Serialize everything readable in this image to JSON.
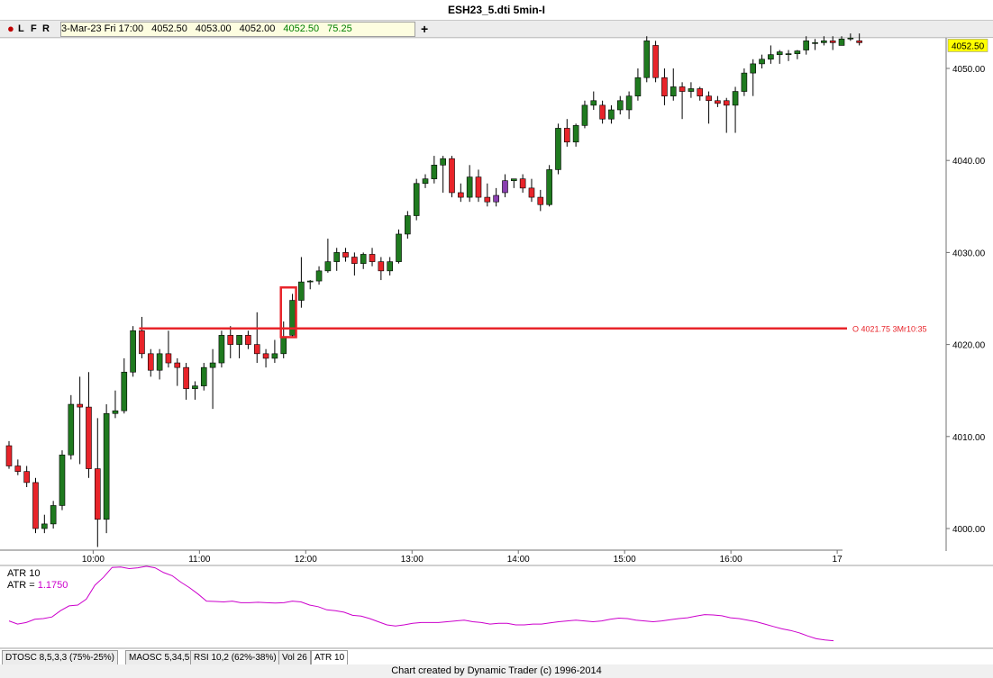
{
  "window": {
    "title": "ESH23_5.dti 5min-I"
  },
  "toolbar": {
    "buttons": [
      "L",
      "F",
      "R"
    ],
    "colors": [
      "#009900",
      "#cc0000",
      "#000099"
    ],
    "quote": [
      "3-Mar-23 Fri 17:00",
      "4052.50",
      "4053.00",
      "4052.00",
      "4052.50",
      "75.25"
    ],
    "plus": "+"
  },
  "indicator": {
    "name": "ATR 10",
    "label": "ATR =",
    "value": "1.1750",
    "color": "#cc00cc"
  },
  "tabs": [
    "DTOSC 8,5,3,3 (75%-25%)",
    "MAOSC 5,34,5",
    "RSI 10,2 (62%-38%)",
    "Vol 26",
    "ATR 10"
  ],
  "active_tab": 4,
  "footer": "Chart created by Dynamic Trader  (c) 1996-2014",
  "chart_data": {
    "type": "candlestick",
    "title": "ESH23_5.dti 5min-I",
    "ylim": [
      3998,
      4053
    ],
    "y_ticks": [
      4000,
      4010,
      4020,
      4030,
      4040,
      4050
    ],
    "y_tick_labels": [
      "4000.00",
      "4010.00",
      "4020.00",
      "4030.00",
      "4040.00",
      "4050.00"
    ],
    "x_tick_labels": [
      "10:00",
      "11:00",
      "12:00",
      "13:00",
      "14:00",
      "15:00",
      "16:00",
      "17"
    ],
    "last_price_label": "4052.50",
    "last_price": 4052.5,
    "up_color": "#1f7a1f",
    "down_color": "#e8242a",
    "candles": [
      [
        4009.0,
        4009.5,
        4006.5,
        4006.8
      ],
      [
        4006.8,
        4007.5,
        4005.8,
        4006.2
      ],
      [
        4006.2,
        4006.8,
        4004.5,
        4005.0
      ],
      [
        4005.0,
        4005.5,
        3999.5,
        4000.0
      ],
      [
        4000.0,
        4001.5,
        3999.5,
        4000.5
      ],
      [
        4000.5,
        4003.0,
        4000.0,
        4002.5
      ],
      [
        4002.5,
        4008.5,
        4002.0,
        4008.0
      ],
      [
        4008.0,
        4014.5,
        4007.5,
        4013.5
      ],
      [
        4013.5,
        4016.5,
        4007.0,
        4013.2
      ],
      [
        4013.2,
        4017.0,
        4005.5,
        4006.5
      ],
      [
        4006.5,
        4012.0,
        3998.0,
        4001.0
      ],
      [
        4001.0,
        4013.5,
        3999.5,
        4012.5
      ],
      [
        4012.5,
        4015.0,
        4012.0,
        4012.8
      ],
      [
        4012.8,
        4018.5,
        4012.5,
        4017.0
      ],
      [
        4017.0,
        4022.0,
        4016.5,
        4021.5
      ],
      [
        4021.5,
        4023.0,
        4018.5,
        4019.0
      ],
      [
        4019.0,
        4019.5,
        4016.5,
        4017.2
      ],
      [
        4017.2,
        4019.5,
        4016.2,
        4019.0
      ],
      [
        4019.0,
        4021.5,
        4017.5,
        4018.0
      ],
      [
        4018.0,
        4018.5,
        4015.5,
        4017.5
      ],
      [
        4017.5,
        4018.0,
        4014.0,
        4015.2
      ],
      [
        4015.2,
        4016.0,
        4014.0,
        4015.5
      ],
      [
        4015.5,
        4018.0,
        4015.0,
        4017.5
      ],
      [
        4017.5,
        4019.5,
        4013.0,
        4018.0
      ],
      [
        4018.0,
        4021.5,
        4017.5,
        4021.0
      ],
      [
        4021.0,
        4022.0,
        4018.5,
        4020.0
      ],
      [
        4020.0,
        4021.0,
        4018.5,
        4021.0
      ],
      [
        4021.0,
        4021.5,
        4019.5,
        4020.0
      ],
      [
        4020.0,
        4023.5,
        4018.0,
        4019.0
      ],
      [
        4019.0,
        4019.5,
        4017.5,
        4018.5
      ],
      [
        4018.5,
        4020.5,
        4018.0,
        4019.0
      ],
      [
        4019.0,
        4022.5,
        4018.5,
        4020.8
      ],
      [
        4021.0,
        4025.5,
        4020.8,
        4024.8
      ],
      [
        4024.8,
        4029.5,
        4024.0,
        4026.8
      ],
      [
        4026.8,
        4027.0,
        4026.0,
        4026.9
      ],
      [
        4026.9,
        4028.5,
        4026.5,
        4028.0
      ],
      [
        4028.0,
        4031.5,
        4027.8,
        4029.0
      ],
      [
        4029.0,
        4030.5,
        4028.0,
        4030.0
      ],
      [
        4030.0,
        4030.5,
        4029.0,
        4029.5
      ],
      [
        4029.5,
        4030.0,
        4027.5,
        4028.8
      ],
      [
        4028.8,
        4030.0,
        4028.2,
        4029.8
      ],
      [
        4029.8,
        4030.5,
        4028.5,
        4029.0
      ],
      [
        4029.0,
        4029.5,
        4027.0,
        4028.0
      ],
      [
        4028.0,
        4029.5,
        4027.5,
        4029.0
      ],
      [
        4029.0,
        4032.5,
        4028.8,
        4032.0
      ],
      [
        4032.0,
        4034.5,
        4031.5,
        4034.0
      ],
      [
        4034.0,
        4038.0,
        4033.5,
        4037.5
      ],
      [
        4037.5,
        4038.5,
        4037.0,
        4038.0
      ],
      [
        4038.0,
        4040.5,
        4037.5,
        4039.5
      ],
      [
        4039.5,
        4040.5,
        4036.5,
        4040.2
      ],
      [
        4040.2,
        4040.5,
        4036.0,
        4036.5
      ],
      [
        4036.5,
        4037.5,
        4035.5,
        4036.0
      ],
      [
        4036.0,
        4039.5,
        4035.5,
        4038.2
      ],
      [
        4038.2,
        4039.0,
        4035.5,
        4036.0
      ],
      [
        4036.0,
        4037.5,
        4035.0,
        4035.5
      ],
      [
        4035.5,
        4037.0,
        4035.0,
        4036.2
      ],
      [
        4036.5,
        4038.5,
        4036.0,
        4037.8
      ],
      [
        4037.8,
        4038.0,
        4037.0,
        4038.0
      ],
      [
        4038.0,
        4038.5,
        4036.5,
        4037.0
      ],
      [
        4037.0,
        4038.0,
        4035.5,
        4036.0
      ],
      [
        4036.0,
        4036.8,
        4034.5,
        4035.2
      ],
      [
        4035.2,
        4039.5,
        4035.0,
        4039.0
      ],
      [
        4039.0,
        4044.0,
        4038.5,
        4043.5
      ],
      [
        4043.5,
        4044.5,
        4041.5,
        4042.0
      ],
      [
        4042.0,
        4044.0,
        4041.5,
        4043.8
      ],
      [
        4043.8,
        4046.5,
        4043.5,
        4046.0
      ],
      [
        4046.0,
        4047.5,
        4045.5,
        4046.5
      ],
      [
        4046.0,
        4046.5,
        4044.0,
        4044.5
      ],
      [
        4044.5,
        4046.0,
        4044.0,
        4045.5
      ],
      [
        4045.5,
        4047.0,
        4045.0,
        4046.5
      ],
      [
        4045.5,
        4047.5,
        4044.5,
        4047.0
      ],
      [
        4047.0,
        4050.0,
        4046.5,
        4049.0
      ],
      [
        4049.0,
        4053.5,
        4048.5,
        4053.0
      ],
      [
        4052.5,
        4053.0,
        4048.5,
        4049.0
      ],
      [
        4049.0,
        4050.0,
        4046.0,
        4047.0
      ],
      [
        4047.0,
        4050.0,
        4046.5,
        4048.0
      ],
      [
        4048.0,
        4048.5,
        4044.5,
        4047.5
      ],
      [
        4047.5,
        4048.5,
        4046.8,
        4047.8
      ],
      [
        4047.8,
        4048.0,
        4046.5,
        4047.0
      ],
      [
        4047.0,
        4047.5,
        4044.0,
        4046.5
      ],
      [
        4046.5,
        4047.0,
        4045.8,
        4046.2
      ],
      [
        4046.5,
        4046.8,
        4043.0,
        4046.0
      ],
      [
        4046.0,
        4048.0,
        4043.0,
        4047.5
      ],
      [
        4047.5,
        4050.0,
        4047.0,
        4049.5
      ],
      [
        4049.5,
        4051.0,
        4047.0,
        4050.5
      ],
      [
        4050.5,
        4051.5,
        4050.0,
        4051.0
      ],
      [
        4051.0,
        4052.5,
        4050.5,
        4051.5
      ],
      [
        4051.5,
        4052.0,
        4050.5,
        4051.8
      ],
      [
        4051.5,
        4052.0,
        4050.8,
        4051.6
      ],
      [
        4051.6,
        4052.0,
        4051.0,
        4051.9
      ],
      [
        4052.0,
        4053.5,
        4051.5,
        4053.0
      ],
      [
        4052.8,
        4053.2,
        4052.0,
        4052.8
      ],
      [
        4052.8,
        4053.5,
        4052.5,
        4053.0
      ],
      [
        4053.0,
        4053.5,
        4052.0,
        4052.8
      ],
      [
        4052.5,
        4053.5,
        4052.5,
        4053.2
      ],
      [
        4053.2,
        4053.8,
        4053.0,
        4053.3
      ],
      [
        4053.0,
        4053.8,
        4052.5,
        4052.8
      ]
    ],
    "highlight_candles": [
      55,
      56
    ],
    "highlight_color": "#8a3fb0",
    "level_line": {
      "price": 4021.75,
      "label": "O 4021.75 3Mr10:35",
      "color": "#e8242a"
    },
    "marked_box": {
      "from_candle": 31,
      "to_candle": 32,
      "low": 4020.8,
      "high": 4026.2
    },
    "atr": {
      "ylim": [
        1.0,
        3.0
      ],
      "values": [
        1.6,
        1.52,
        1.56,
        1.64,
        1.66,
        1.7,
        1.86,
        1.98,
        2.0,
        2.15,
        2.5,
        2.7,
        2.95,
        2.96,
        2.92,
        2.94,
        2.98,
        2.94,
        2.82,
        2.74,
        2.58,
        2.44,
        2.28,
        2.1,
        2.09,
        2.08,
        2.1,
        2.06,
        2.06,
        2.07,
        2.06,
        2.05,
        2.06,
        2.1,
        2.08,
        2.0,
        1.96,
        1.88,
        1.86,
        1.82,
        1.74,
        1.72,
        1.66,
        1.58,
        1.5,
        1.47,
        1.5,
        1.54,
        1.56,
        1.56,
        1.56,
        1.58,
        1.6,
        1.62,
        1.58,
        1.56,
        1.52,
        1.54,
        1.54,
        1.5,
        1.5,
        1.52,
        1.52,
        1.55,
        1.58,
        1.6,
        1.62,
        1.6,
        1.58,
        1.6,
        1.64,
        1.67,
        1.66,
        1.62,
        1.6,
        1.58,
        1.6,
        1.63,
        1.66,
        1.68,
        1.72,
        1.76,
        1.75,
        1.73,
        1.68,
        1.66,
        1.62,
        1.58,
        1.52,
        1.46,
        1.4,
        1.36,
        1.3,
        1.22,
        1.15,
        1.12,
        1.1
      ]
    }
  }
}
